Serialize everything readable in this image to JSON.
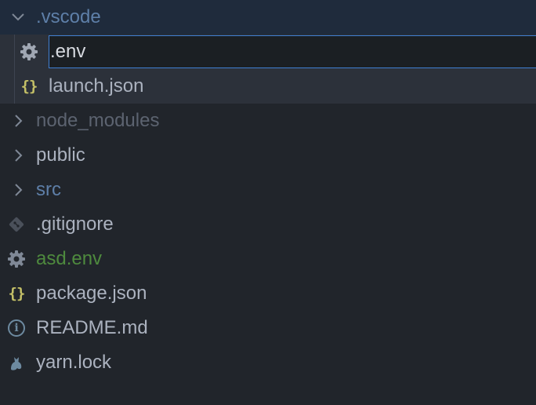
{
  "explorer": {
    "vscode_folder": {
      "name": ".vscode"
    },
    "rename_input": {
      "value": ".env"
    },
    "launch_json": {
      "name": "launch.json"
    },
    "node_modules": {
      "name": "node_modules"
    },
    "public": {
      "name": "public"
    },
    "src": {
      "name": "src"
    },
    "gitignore": {
      "name": ".gitignore"
    },
    "asd_env": {
      "name": "asd.env"
    },
    "package_json": {
      "name": "package.json"
    },
    "readme": {
      "name": "README.md"
    },
    "yarn_lock": {
      "name": "yarn.lock"
    }
  },
  "colors": {
    "background": "#21252b",
    "text": "#abb2bf",
    "folder_muted": "#5c6370",
    "src_blue": "#5e7fa8",
    "env_green": "#4e8a3e",
    "json_yellow": "#c4c067",
    "input_border": "#3f7fd3"
  },
  "icons": {
    "gear": "gear-icon",
    "json": "json-braces-icon",
    "chevron_down": "chevron-down-icon",
    "chevron_right": "chevron-right-icon",
    "git": "git-icon",
    "info": "info-icon",
    "yarn": "yarn-cat-icon"
  }
}
